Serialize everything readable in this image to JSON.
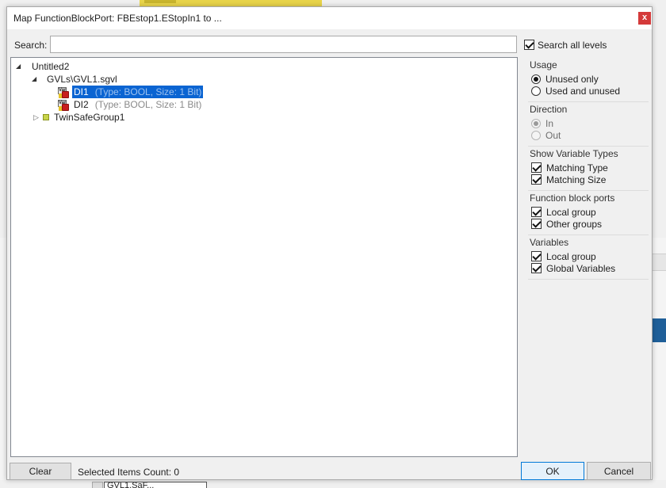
{
  "dialog": {
    "title": "Map FunctionBlockPort: FBEstop1.EStopIn1 to ...",
    "close_glyph": "x"
  },
  "search": {
    "label": "Search:",
    "value": "",
    "placeholder": "",
    "search_all_levels_label": "Search all levels",
    "search_all_levels_checked": true
  },
  "tree": {
    "root": "Untitled2",
    "gvl": "GVLs\\GVL1.sgvl",
    "items": [
      {
        "name": "DI1",
        "type": "(Type: BOOL, Size: 1 Bit)",
        "selected": true
      },
      {
        "name": "DI2",
        "type": "(Type: BOOL, Size: 1 Bit)",
        "selected": false
      }
    ],
    "group": "TwinSafeGroup1"
  },
  "panel": {
    "usage": {
      "title": "Usage",
      "opt1": "Unused only",
      "opt2": "Used and unused",
      "selected": "Unused only"
    },
    "direction": {
      "title": "Direction",
      "opt1": "In",
      "opt2": "Out",
      "selected": "In",
      "disabled": true
    },
    "show_types": {
      "title": "Show Variable Types",
      "opt1": "Matching Type",
      "opt2": "Matching Size"
    },
    "fb_ports": {
      "title": "Function block ports",
      "opt1": "Local group",
      "opt2": "Other groups"
    },
    "variables": {
      "title": "Variables",
      "opt1": "Local group",
      "opt2": "Global Variables"
    }
  },
  "footer": {
    "clear_label": "Clear",
    "selected_count": "Selected Items Count: 0",
    "ok_label": "OK",
    "cancel_label": "Cancel"
  },
  "background": {
    "bottom_combo_value": "GVL1.SaF..."
  },
  "colors": {
    "selection": "#0a64d2",
    "close": "#d43a3a",
    "ok_border": "#0078d7"
  }
}
